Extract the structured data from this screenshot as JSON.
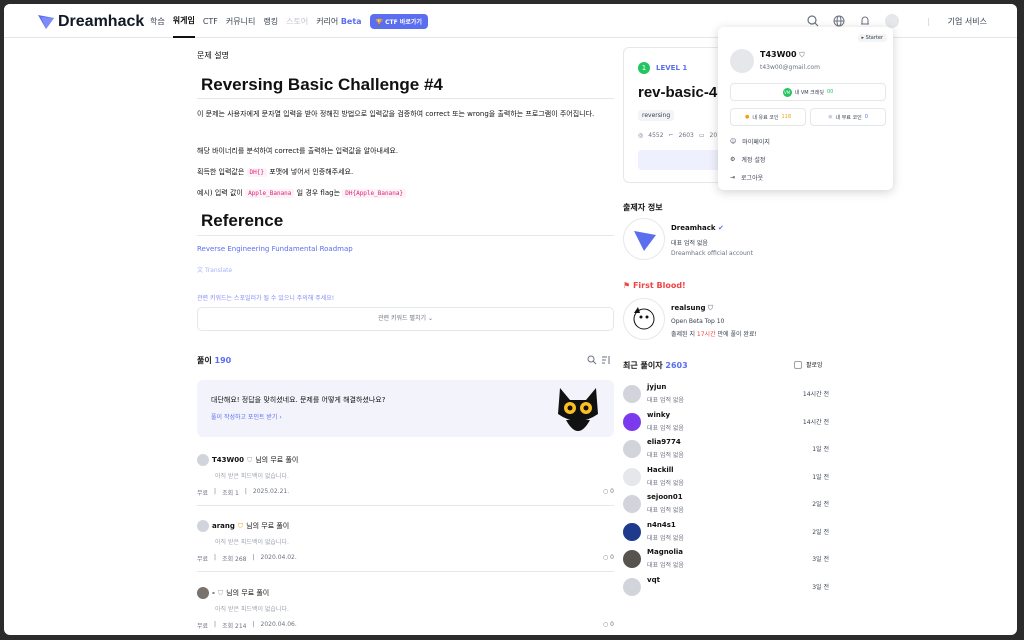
{
  "header": {
    "logo": "Dreamhack",
    "nav": [
      "학습",
      "워게임",
      "CTF",
      "커뮤니티",
      "랭킹",
      "스토어",
      "커리어"
    ],
    "beta": "Beta",
    "ctf_button": "CTF 바로가기",
    "business": "기업 서비스"
  },
  "problem": {
    "section_label": "문제 설명",
    "title": "Reversing Basic Challenge #4",
    "desc1": "이 문제는 사용자에게 문자열 입력을 받아 정해진 방법으로 입력값을 검증하여 correct 또는 wrong을 출력하는 프로그램이 주어집니다.",
    "desc2": "해당 바이너리를 분석하여 correct를 출력하는 입력값을 알아내세요.",
    "flag_pre": "획득한 입력값은",
    "flag_code": "DH{}",
    "flag_post": "포맷에 넣어서 인증해주세요.",
    "ex_pre": "예시) 입력 값이",
    "ex_code1": "Apple_Banana",
    "ex_mid": "일 경우 flag는",
    "ex_code2": "DH{Apple_Banana}",
    "ref_title": "Reference",
    "ref_link": "Reverse Engineering Fundamental Roadmap",
    "translate": "Translate",
    "kw_warn": "관련 키워드는 스포일러가 될 수 있으니 주의해 주세요!",
    "kw_button": "관련 키워드 펼치기"
  },
  "writeups": {
    "label": "풀이",
    "count": "190",
    "banner_title": "대단해요! 정답을 맞히셨네요. 문제를 어떻게 해결하셨나요?",
    "banner_link": "풀이 작성하고 포인트 받기",
    "items": [
      {
        "user": "T43W00",
        "suffix": "님의 무료 풀이",
        "note": "아직 받은 피드백이 없습니다.",
        "price": "무료",
        "views": "조회 1",
        "date": "2025.02.21.",
        "comments": "0"
      },
      {
        "user": "arang",
        "suffix": "님의 무료 풀이",
        "note": "아직 받은 피드백이 없습니다.",
        "price": "무료",
        "views": "조회 268",
        "date": "2020.04.02.",
        "comments": "0"
      },
      {
        "user": "-",
        "suffix": "님의 무료 풀이",
        "note": "아직 받은 피드백이 없습니다.",
        "price": "무료",
        "views": "조회 214",
        "date": "2020.04.06.",
        "comments": "0"
      }
    ]
  },
  "challenge": {
    "level": "LEVEL 1",
    "name": "rev-basic-4",
    "tag": "reversing",
    "solvers": "4552",
    "writeups": "2603",
    "date_partial": "20",
    "button_partial": "문제"
  },
  "author": {
    "label": "출제자 정보",
    "name": "Dreamhack",
    "rep": "대표 업적 없음",
    "desc": "Dreamhack official account"
  },
  "first_blood": {
    "label": "First Blood!",
    "name": "realsung",
    "title": "Open Beta Top 10",
    "pre": "출제된 지",
    "time": "17시간",
    "post": "만에 풀이 완료!"
  },
  "solvers": {
    "label": "최근 풀이자",
    "count": "2603",
    "follow": "팔로잉",
    "list": [
      {
        "name": "jyjun",
        "rep": "대표 업적 없음",
        "time": "14시간 전"
      },
      {
        "name": "winky",
        "rep": "대표 업적 없음",
        "time": "14시간 전"
      },
      {
        "name": "elia9774",
        "rep": "대표 업적 없음",
        "time": "1일 전"
      },
      {
        "name": "Hackill",
        "rep": "대표 업적 없음",
        "time": "1일 전"
      },
      {
        "name": "sejoon01",
        "rep": "대표 업적 없음",
        "time": "2일 전"
      },
      {
        "name": "n4n4s1",
        "rep": "대표 업적 없음",
        "time": "2일 전"
      },
      {
        "name": "Magnolia",
        "rep": "대표 업적 없음",
        "time": "3일 전"
      },
      {
        "name": "vqt",
        "rep": "",
        "time": "3일 전"
      }
    ]
  },
  "user_menu": {
    "badge": "Starter",
    "name": "T43W00",
    "email": "t43w00@gmail.com",
    "vm": "내 VM 크레딧",
    "vm_val": "00",
    "paid_coin": "내 유료 코인",
    "paid_val": "118",
    "free_coin": "내 무료 코인",
    "free_val": "0",
    "mypage": "마이페이지",
    "settings": "계정 설정",
    "logout": "로그아웃"
  },
  "colors": {
    "accent": "#5b6ef0",
    "green": "#22c55e",
    "red": "#ef4444"
  }
}
